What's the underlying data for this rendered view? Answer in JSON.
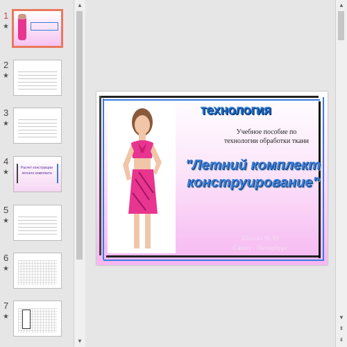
{
  "thumbnails": [
    {
      "num": "1",
      "star": "★",
      "selected": true
    },
    {
      "num": "2",
      "star": "★",
      "selected": false
    },
    {
      "num": "3",
      "star": "★",
      "selected": false
    },
    {
      "num": "4",
      "star": "★",
      "selected": false
    },
    {
      "num": "5",
      "star": "★",
      "selected": false
    },
    {
      "num": "6",
      "star": "★",
      "selected": false
    },
    {
      "num": "7",
      "star": "★",
      "selected": false
    }
  ],
  "thumb_text": {
    "t4": "Расчет конструкции летнего комплекта"
  },
  "slide": {
    "title": "технология",
    "subtitle_line1": "Учебное пособие по",
    "subtitle_line2": "технологии обработки ткани",
    "headline_line1": "\"Летний комплект",
    "headline_line2": "конструирование\"",
    "school_line1": "Школа № 89",
    "school_line2": "Санкт - Петербург"
  },
  "scroll": {
    "up": "▲",
    "down": "▼",
    "prev": "⇞",
    "next": "⇟"
  },
  "colors": {
    "selection": "#e8795c",
    "title": "#1a5fb4",
    "headline": "#3b7ed8",
    "dress": "#e8358f"
  }
}
